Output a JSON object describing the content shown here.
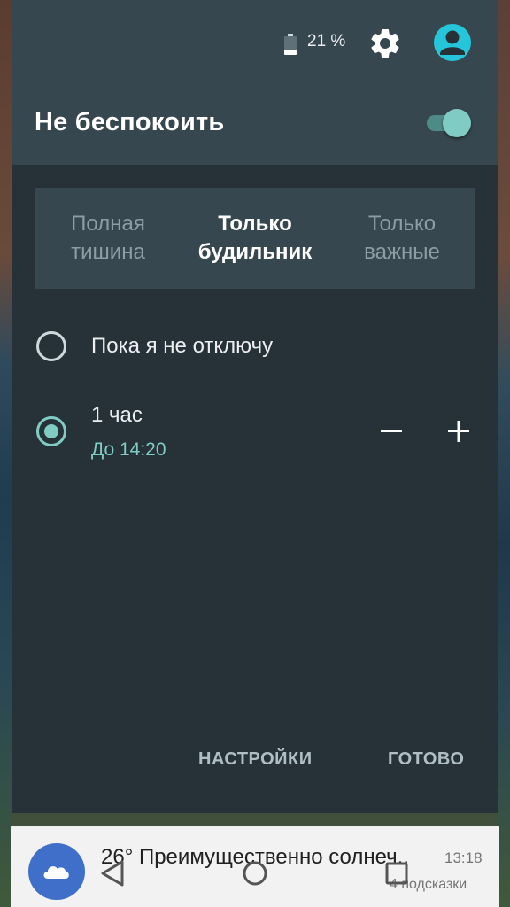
{
  "status": {
    "battery_text": "21 %",
    "battery_icon": "battery-icon",
    "settings_icon": "gear-icon",
    "account_icon": "account-icon"
  },
  "dnd": {
    "title": "Не беспокоить",
    "enabled": true,
    "accent_color": "#80cbc4",
    "modes": [
      {
        "label": "Полная\nтишина",
        "active": false
      },
      {
        "label": "Только\nбудильник",
        "active": true
      },
      {
        "label": "Только\nважные",
        "active": false
      }
    ],
    "options": {
      "until_off": {
        "label": "Пока я не отключу",
        "selected": false
      },
      "duration": {
        "label": "1 час",
        "until": "До 14:20",
        "selected": true,
        "minus_icon": "minus-icon",
        "plus_icon": "plus-icon"
      }
    },
    "actions": {
      "settings": "НАСТРОЙКИ",
      "done": "ГОТОВО"
    }
  },
  "notification": {
    "icon": "cloud-icon",
    "title": "26° Преимущественно солнеч..",
    "time": "13:18",
    "subtitle": "4 подсказки",
    "icon_color": "#3f6fc9"
  },
  "navbar": {
    "back_icon": "back-icon",
    "home_icon": "home-icon",
    "recents_icon": "recents-icon"
  }
}
